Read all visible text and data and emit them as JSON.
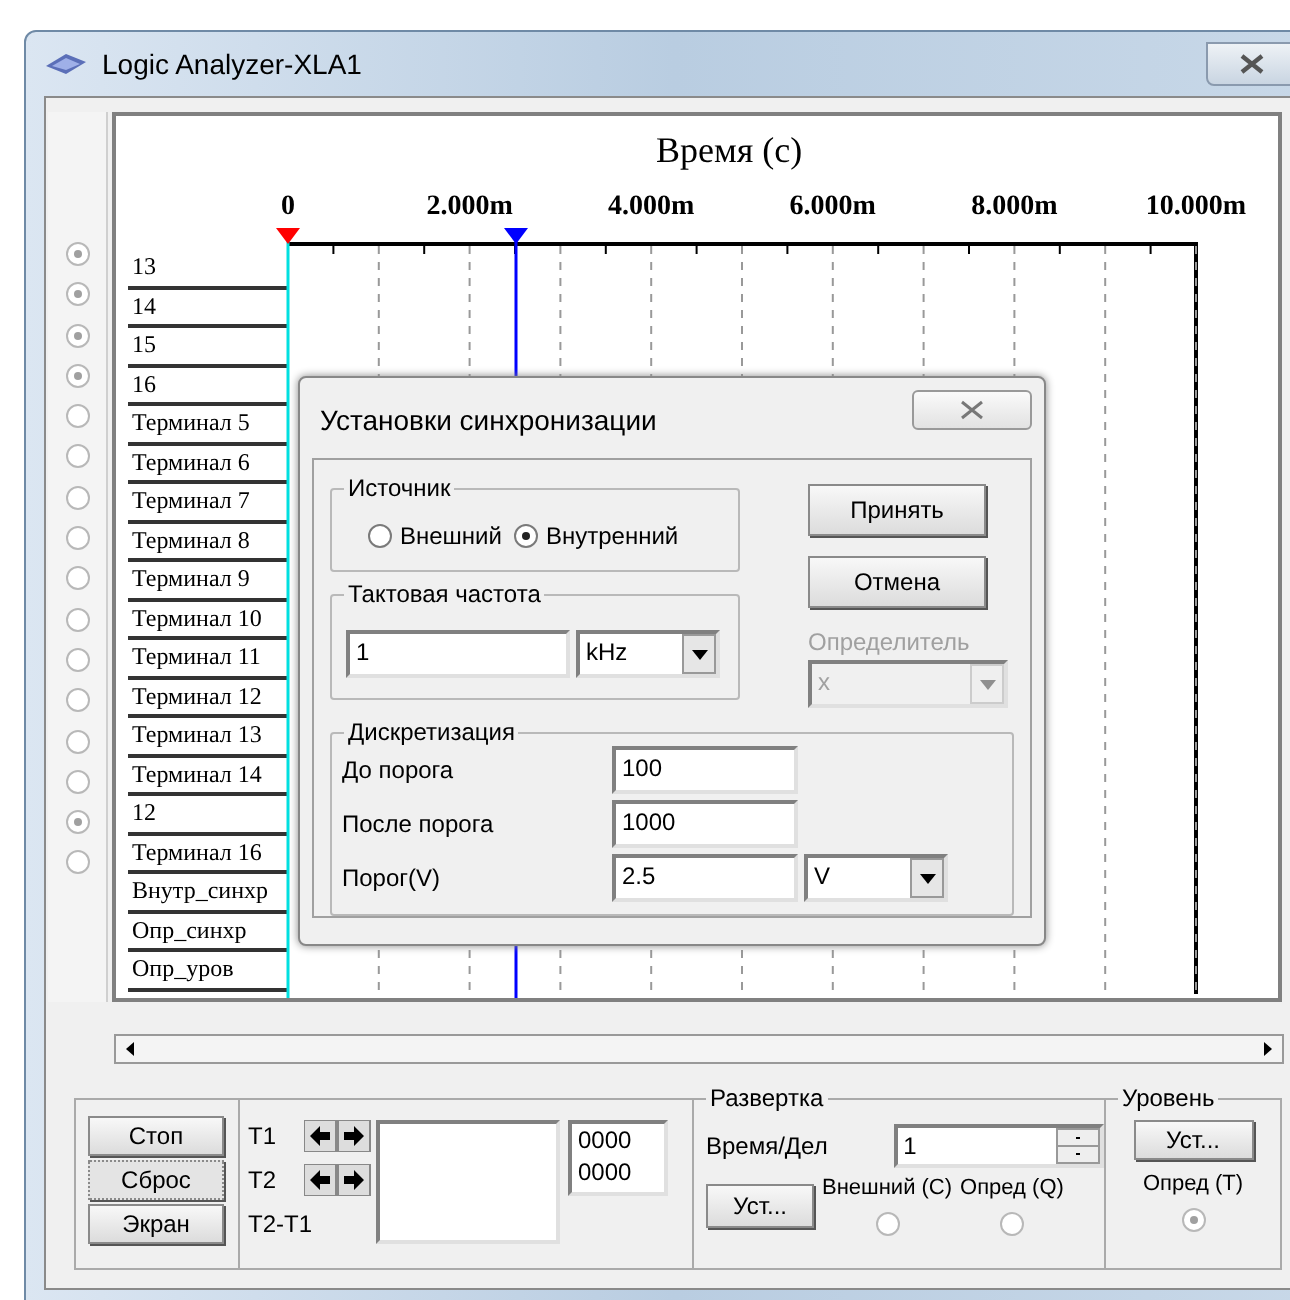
{
  "window": {
    "title": "Logic Analyzer-XLA1"
  },
  "plot": {
    "axis_title": "Время (с)",
    "ticks": [
      "0",
      "2.000m",
      "4.000m",
      "6.000m",
      "8.000m",
      "10.000m"
    ],
    "cursors": [
      {
        "level": 0,
        "marker": {
          "color": "#ff0000"
        },
        "line": {
          "color": "#00e0e0"
        }
      },
      {
        "level": 0.25,
        "marker": {
          "color": "#0000ff"
        },
        "line": {
          "color": "#0000ff"
        }
      }
    ],
    "channels": [
      "13",
      "14",
      "15",
      "16",
      "Терминал 5",
      "Терминал 6",
      "Терминал 7",
      "Терминал 8",
      "Терминал 9",
      "Терминал 10",
      "Терминал 11",
      "Терминал 12",
      "Терминал 13",
      "Терминал 14",
      "12",
      "Терминал 16",
      "Внутр_синхр",
      "Опр_синхр",
      "Опр_уров"
    ],
    "trigger_radios": [
      {
        "checked": true
      },
      {
        "checked": true
      },
      {
        "checked": true
      },
      {
        "checked": true
      },
      {
        "checked": false
      },
      {
        "checked": false
      },
      {
        "checked": false
      },
      {
        "checked": false
      },
      {
        "checked": false
      },
      {
        "checked": false
      },
      {
        "checked": false
      },
      {
        "checked": false
      },
      {
        "checked": false
      },
      {
        "checked": false
      },
      {
        "checked": true
      },
      {
        "checked": false
      }
    ]
  },
  "dialog": {
    "title": "Установки синхронизации",
    "source": {
      "label": "Источник",
      "options": [
        {
          "label": "Внешний",
          "selected": false
        },
        {
          "label": "Внутренний",
          "selected": true
        }
      ]
    },
    "clock": {
      "label": "Тактовая частота",
      "value": "1",
      "unit": "kHz"
    },
    "qualifier": {
      "label": "Определитель",
      "value": "x",
      "disabled": true
    },
    "sampling": {
      "label": "Дискретизация",
      "fields": [
        {
          "label": "До порога",
          "value": "100"
        },
        {
          "label": "После порога",
          "value": "1000"
        },
        {
          "label": "Порог(V)",
          "value": "2.5",
          "unit": "V"
        }
      ]
    },
    "buttons": [
      "Принять",
      "Отмена"
    ]
  },
  "controls": {
    "buttons": [
      {
        "label": "Стоп",
        "pressed": false
      },
      {
        "label": "Сброс",
        "pressed": true
      },
      {
        "label": "Экран",
        "pressed": false
      }
    ],
    "cursor_labels": [
      "T1",
      "T2",
      "T2-T1"
    ],
    "readouts": [
      "0000",
      "0000"
    ],
    "timebase": {
      "title": "Развертка",
      "label": "Время/Дел",
      "value": "1",
      "button": "Уст...",
      "options": [
        {
          "label": "Внешний (C)",
          "selected": false
        },
        {
          "label": "Опред (Q)",
          "selected": false
        }
      ]
    },
    "level": {
      "title": "Уровень",
      "button": "Уст...",
      "options": [
        {
          "label": "Опред (T)",
          "selected": true
        }
      ]
    }
  }
}
